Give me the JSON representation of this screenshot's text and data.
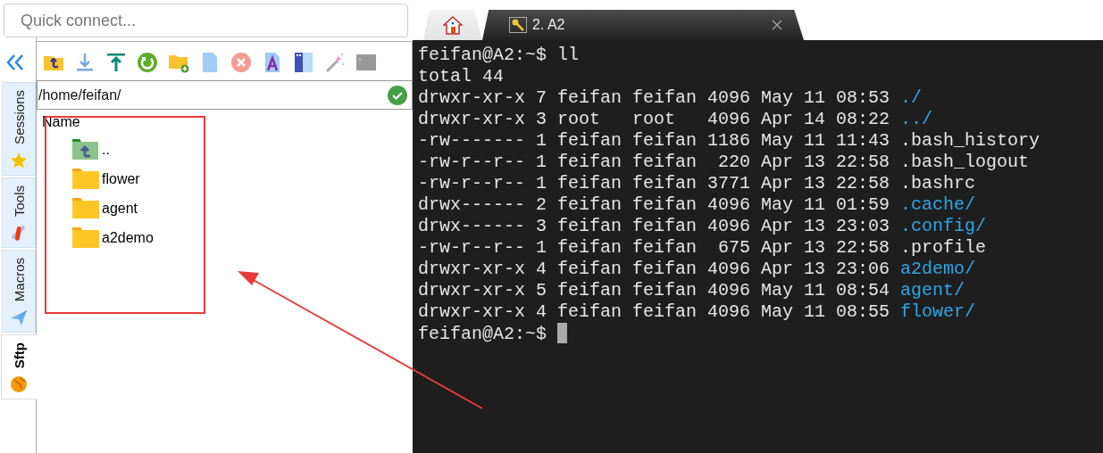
{
  "quick_connect": {
    "placeholder": "Quick connect..."
  },
  "side_tabs": [
    {
      "label": "Sessions",
      "kind": "star",
      "selected": false
    },
    {
      "label": "Tools",
      "kind": "tools",
      "selected": false
    },
    {
      "label": "Macros",
      "kind": "plane",
      "selected": false
    },
    {
      "label": "Sftp",
      "kind": "globe",
      "selected": true
    }
  ],
  "sftp": {
    "toolbar": [
      {
        "kind": "up"
      },
      {
        "kind": "download"
      },
      {
        "kind": "upload"
      },
      {
        "kind": "refresh"
      },
      {
        "kind": "newfolder"
      },
      {
        "kind": "file"
      },
      {
        "kind": "delete"
      },
      {
        "kind": "textfile"
      },
      {
        "kind": "panel"
      },
      {
        "kind": "wand"
      },
      {
        "kind": "terminal"
      }
    ],
    "path": "/home/feifan/",
    "column": "Name",
    "items": [
      {
        "name": "..",
        "kind": "parent"
      },
      {
        "name": "flower",
        "kind": "folder"
      },
      {
        "name": "agent",
        "kind": "folder"
      },
      {
        "name": "a2demo",
        "kind": "folder"
      }
    ]
  },
  "tabs": [
    {
      "kind": "home",
      "selected": false
    },
    {
      "kind": "session",
      "label": "2. A2",
      "selected": true
    }
  ],
  "terminal": {
    "lines": [
      {
        "kind": "prompt",
        "text": "feifan@A2:~$ ll",
        "cursor": false
      },
      {
        "kind": "text",
        "text": "total 44"
      },
      {
        "kind": "dir",
        "meta": "drwxr-xr-x 7 feifan feifan 4096 May 11 08:53",
        "name": "./"
      },
      {
        "kind": "dir",
        "meta": "drwxr-xr-x 3 root   root   4096 Apr 14 08:22",
        "name": "../"
      },
      {
        "kind": "file",
        "meta": "-rw------- 1 feifan feifan 1186 May 11 11:43",
        "name": ".bash_history"
      },
      {
        "kind": "file",
        "meta": "-rw-r--r-- 1 feifan feifan  220 Apr 13 22:58",
        "name": ".bash_logout"
      },
      {
        "kind": "file",
        "meta": "-rw-r--r-- 1 feifan feifan 3771 Apr 13 22:58",
        "name": ".bashrc"
      },
      {
        "kind": "dir",
        "meta": "drwx------ 2 feifan feifan 4096 May 11 01:59",
        "name": ".cache/"
      },
      {
        "kind": "dir",
        "meta": "drwx------ 3 feifan feifan 4096 Apr 13 23:03",
        "name": ".config/"
      },
      {
        "kind": "file",
        "meta": "-rw-r--r-- 1 feifan feifan  675 Apr 13 22:58",
        "name": ".profile"
      },
      {
        "kind": "dir",
        "meta": "drwxr-xr-x 4 feifan feifan 4096 Apr 13 23:06",
        "name": "a2demo/"
      },
      {
        "kind": "dir",
        "meta": "drwxr-xr-x 5 feifan feifan 4096 May 11 08:54",
        "name": "agent/"
      },
      {
        "kind": "dir",
        "meta": "drwxr-xr-x 4 feifan feifan 4096 May 11 08:55",
        "name": "flower/"
      },
      {
        "kind": "prompt",
        "text": "feifan@A2:~$",
        "cursor": true
      }
    ]
  }
}
